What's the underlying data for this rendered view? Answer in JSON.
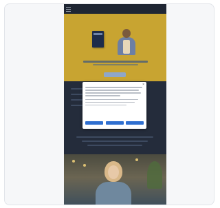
{
  "header": {
    "menu_icon": "hamburger-menu-icon",
    "brand": "",
    "logo_text": ""
  },
  "hero": {
    "button_label": ""
  },
  "cookie_dialog": {
    "title": "",
    "close_icon": "close-icon",
    "buttons": [
      {
        "label": ""
      },
      {
        "label": ""
      },
      {
        "label": ""
      }
    ]
  },
  "colors": {
    "hero_background": "#c8a431",
    "page_background": "#242c3b",
    "dialog_button": "#2f6fd0"
  }
}
